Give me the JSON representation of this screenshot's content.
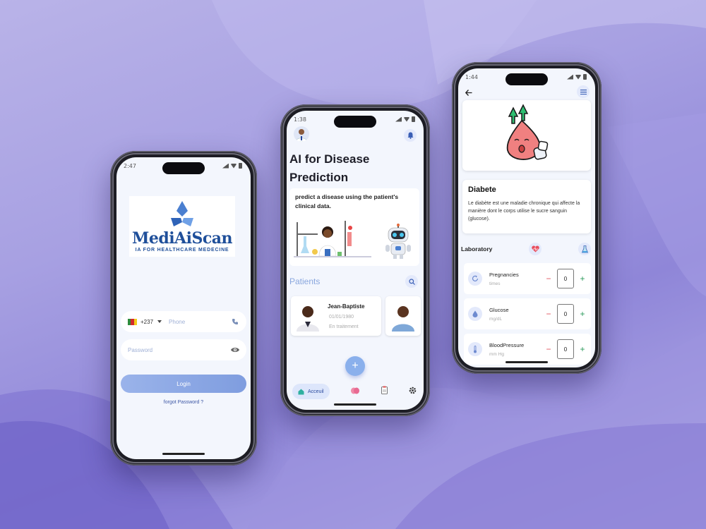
{
  "login": {
    "status_time": "2:47",
    "logo_title": "MediAiScan",
    "logo_subtitle": "IA FOR HEALTHCARE MEDECINE",
    "country_code": "+237",
    "phone_placeholder": "Phone",
    "password_placeholder": "Password",
    "login_label": "Login",
    "forgot_label": "forgot Password ?"
  },
  "home": {
    "status_time": "1:38",
    "title_line1": "AI for Disease",
    "title_line2": "Prediction",
    "predict_text": "predict a disease using the patient's clinical data.",
    "patients_label": "Patients",
    "patient": {
      "name": "Jean-Baptiste",
      "dob": "01/01/1980",
      "status": "En traitement"
    },
    "fab_label": "+",
    "nav": {
      "home_label": "Acceuil"
    }
  },
  "detail": {
    "status_time": "1:44",
    "disease_title": "Diabete",
    "disease_desc": "Le diabète est une maladie chronique qui affecte la manière dont le corps utilise le sucre sanguin (glucose).",
    "lab_label": "Laboratory",
    "rows": [
      {
        "name": "Pregnancies",
        "unit": "times",
        "value": "0"
      },
      {
        "name": "Glucose",
        "unit": "mg/dL",
        "value": "0"
      },
      {
        "name": "BloodPressure",
        "unit": "mm Hg",
        "value": "0"
      }
    ],
    "minus": "−",
    "plus": "+"
  },
  "colors": {
    "accent": "#8ab0ec",
    "primary_text": "#1f4f9a",
    "minus": "#e0505a",
    "plus": "#2a9a5a"
  }
}
